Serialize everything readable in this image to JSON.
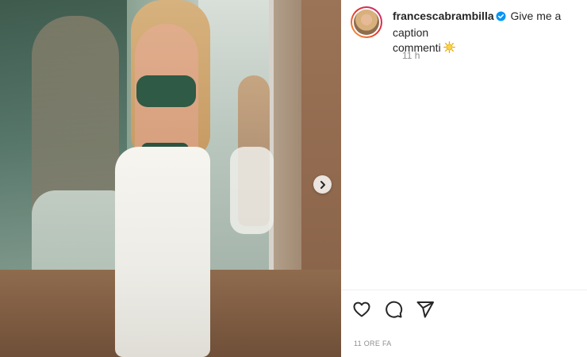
{
  "caption": {
    "username": "francescabrambilla",
    "text": "Give me a caption",
    "text_line2": "commenti",
    "emoji": "sun-emoji"
  },
  "meta": {
    "time_ago": "11 h",
    "post_date": "11 ORE FA"
  },
  "icons": {
    "verified": "verified-badge-icon",
    "next": "chevron-right-icon",
    "like": "heart-icon",
    "comment": "comment-bubble-icon",
    "share": "paper-plane-icon"
  },
  "colors": {
    "text": "#262626",
    "muted": "#8e8e8e",
    "verified": "#0095f6",
    "divider": "#efefef"
  }
}
